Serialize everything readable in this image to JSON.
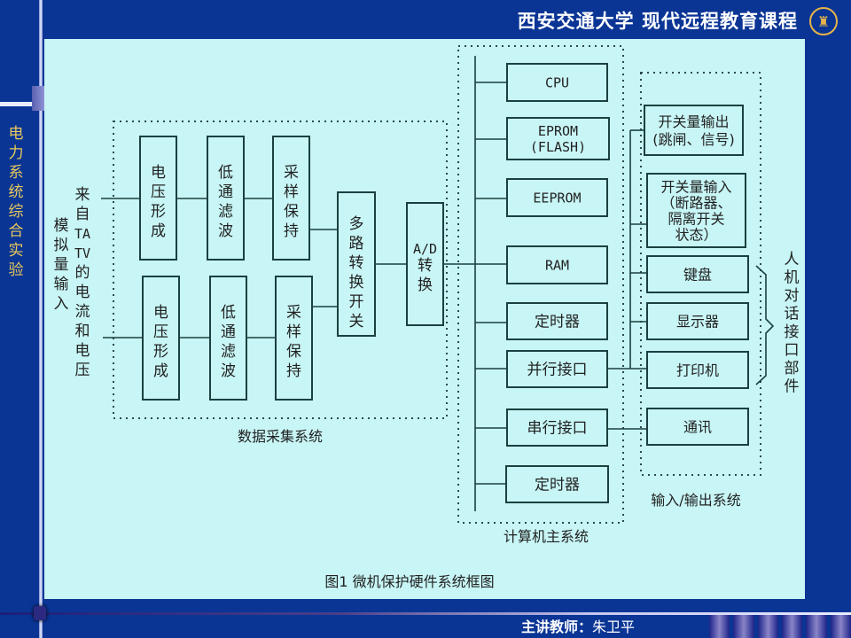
{
  "header": {
    "title": "西安交通大学  现代远程教育课程",
    "logo_icon": "university-emblem-icon"
  },
  "sidebar": {
    "course_title": "电力系统综合实验"
  },
  "footer": {
    "lecturer_label": "主讲教师：",
    "lecturer_name": "朱卫平"
  },
  "diagram": {
    "caption": "图1 微机保护硬件系统框图",
    "input_label_col1": "来自TA TV的电流和电压",
    "input_label_col2": "模拟量输入",
    "data_acquisition": {
      "title": "数据采集系统",
      "channel_1": [
        "电压形成",
        "低通滤波",
        "采样保持"
      ],
      "channel_2": [
        "电压形成",
        "低通滤波",
        "采样保持"
      ],
      "multiplexer": "多路转换开关",
      "adc": "A/D转换"
    },
    "computer_main": {
      "title": "计算机主系统",
      "modules": [
        "CPU",
        "EPROM\n(FLASH)",
        "EEPROM",
        "RAM",
        "定时器",
        "并行接口",
        "串行接口",
        "定时器"
      ]
    },
    "io_system": {
      "title": "输入/输出系统",
      "modules": [
        "开关量输出\n(跳闸、信号)",
        "开关量输入\n（断路器、\n隔离开关\n状态）",
        "键盘",
        "显示器",
        "打印机",
        "通讯"
      ],
      "hmi_label": "人机对话接口部件"
    }
  }
}
